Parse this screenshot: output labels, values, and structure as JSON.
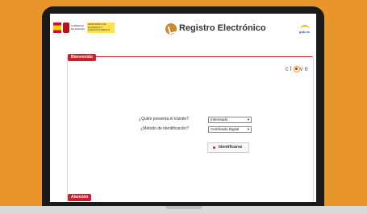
{
  "header": {
    "gov_text": "GOBIERNO DE ESPAÑA",
    "ministry_text": "MINISTERIO DE HACIENDA Y FUNCIÓN PÚBLICA",
    "app_title": "Registro Electrónico",
    "corner_logo_text": "gob.es"
  },
  "panel": {
    "tab_label": "Bienvenido",
    "brand": [
      "cl",
      "ve"
    ],
    "form": {
      "q1_label": "¿Quién presenta el trámite?",
      "q1_value": "Interesado",
      "q2_label": "¿Método de identificación?",
      "q2_value": "Certificado Digital",
      "submit_label": "Identificarse"
    },
    "footer_tab": "Atención"
  },
  "colors": {
    "background": "#e8962a",
    "accent": "#cc1f2e"
  }
}
